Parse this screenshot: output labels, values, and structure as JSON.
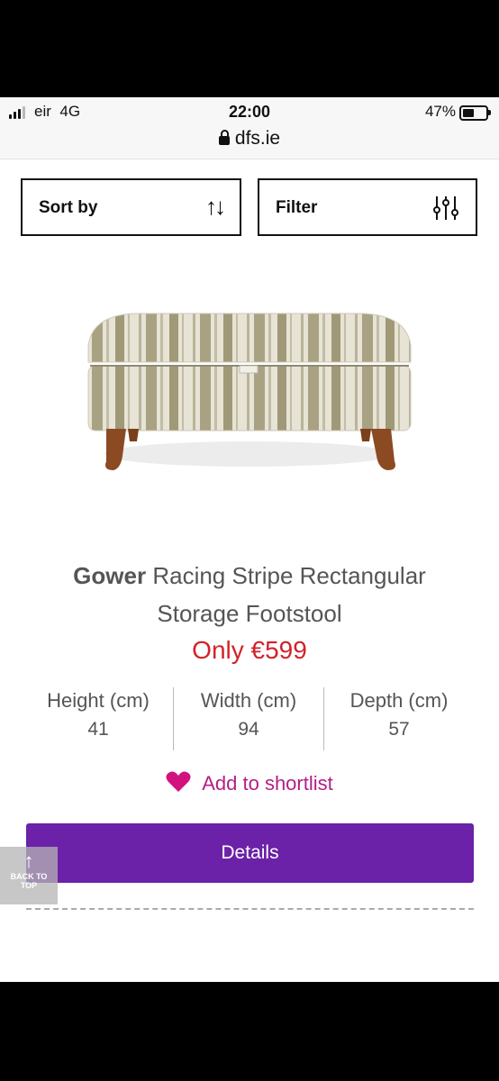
{
  "status_bar": {
    "carrier": "eir",
    "network": "4G",
    "time": "22:00",
    "battery": "47%",
    "url": "dfs.ie"
  },
  "controls": {
    "sort_label": "Sort by",
    "filter_label": "Filter"
  },
  "product": {
    "brand": "Gower",
    "title_line1": "Racing Stripe Rectangular",
    "title_line2": "Storage Footstool",
    "price": "Only €599",
    "dimensions": [
      {
        "label": "Height (cm)",
        "value": "41"
      },
      {
        "label": "Width (cm)",
        "value": "94"
      },
      {
        "label": "Depth (cm)",
        "value": "57"
      }
    ],
    "shortlist_label": "Add to shortlist",
    "details_label": "Details"
  },
  "back_to_top": {
    "line1": "BACK TO",
    "line2": "TOP"
  },
  "colors": {
    "accent_purple": "#6b21a8",
    "price_red": "#d3222a",
    "shortlist_pink": "#b41e85"
  }
}
